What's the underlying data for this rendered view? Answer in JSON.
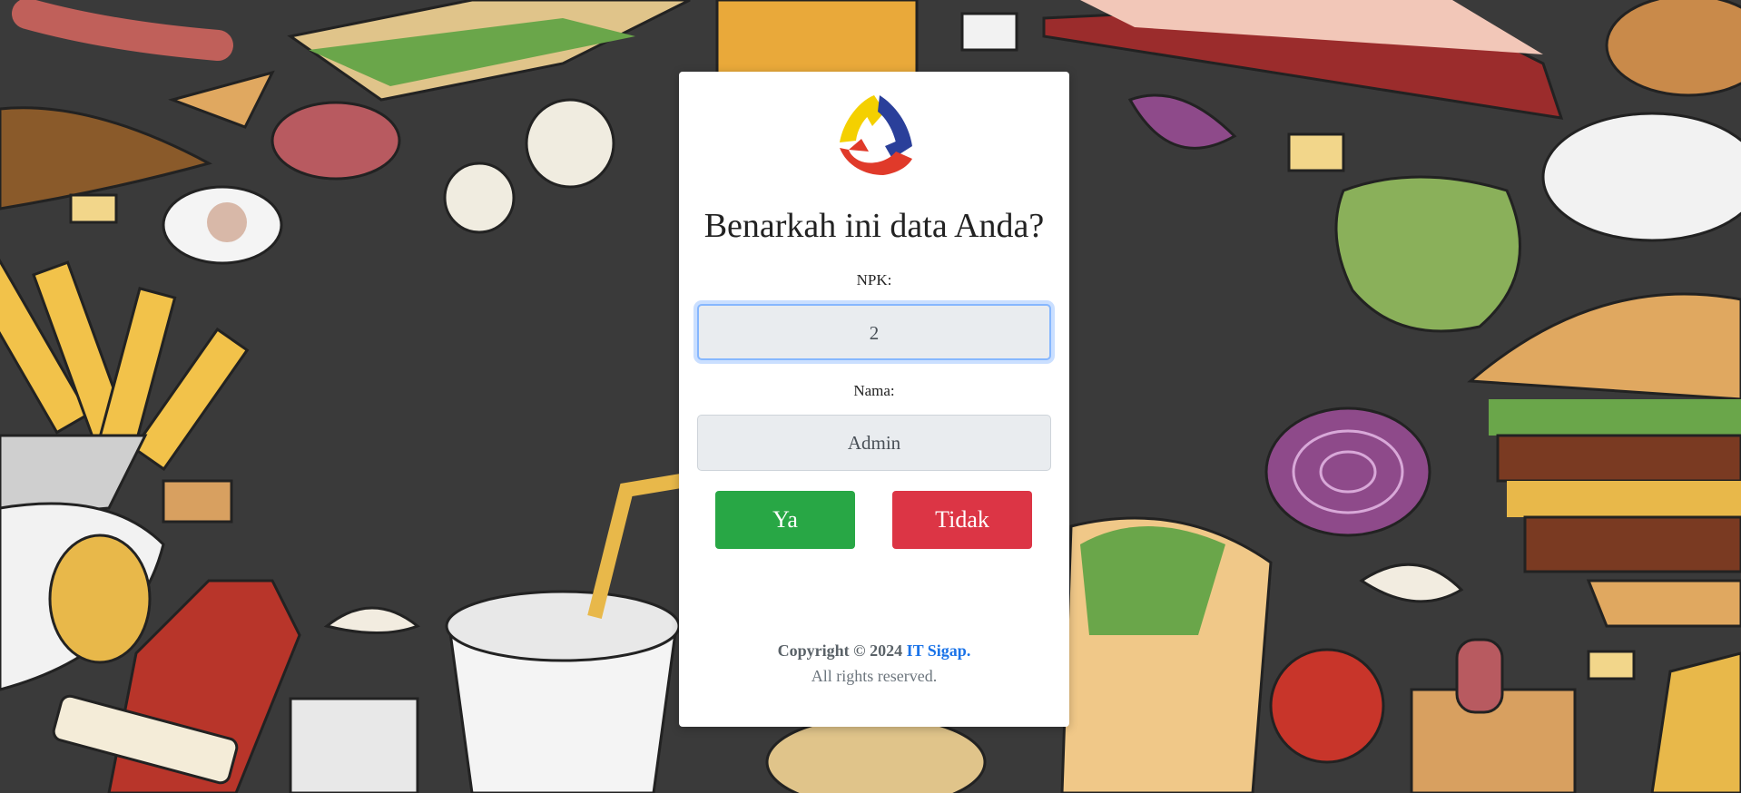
{
  "page": {
    "title": "Benarkah ini data Anda?"
  },
  "form": {
    "npk_label": "NPK:",
    "npk_value": "2",
    "nama_label": "Nama:",
    "nama_value": "Admin"
  },
  "actions": {
    "yes_label": "Ya",
    "no_label": "Tidak"
  },
  "footer": {
    "copyright_prefix": "Copyright © 2024",
    "brand": "IT Sigap.",
    "rights": "All rights reserved."
  },
  "colors": {
    "yes_button": "#28a745",
    "no_button": "#dc3545",
    "brand_link": "#1a73e8",
    "background": "#3a3a3a"
  },
  "icons": {
    "logo": "tri-color-triangle-logo-icon"
  }
}
